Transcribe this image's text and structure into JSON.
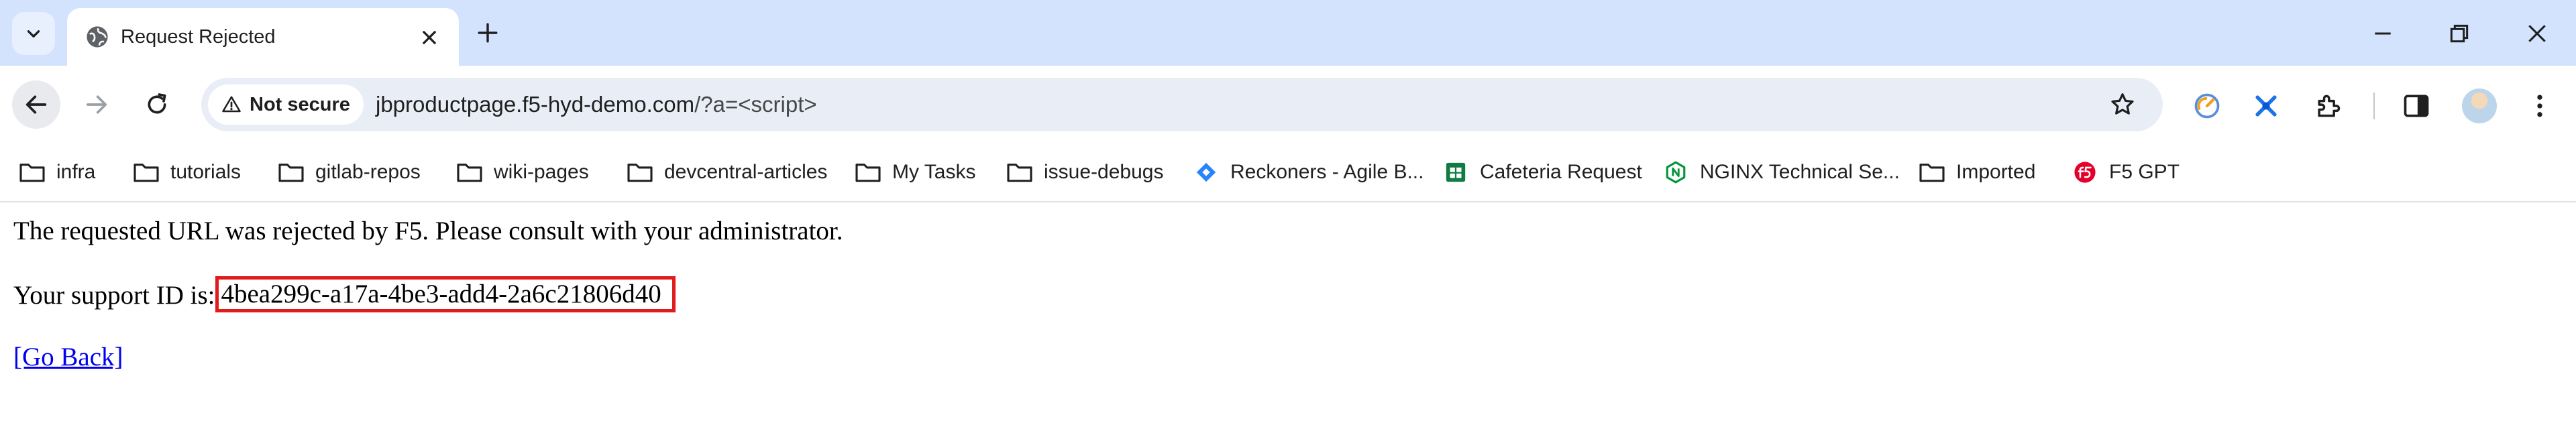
{
  "tab": {
    "title": "Request Rejected"
  },
  "toolbar": {
    "security_chip": "Not secure",
    "url_host": "jbproductpage.f5-hyd-demo.com",
    "url_path": "/?a=<script>"
  },
  "bookmarks": [
    {
      "label": "infra",
      "icon": "folder-icon"
    },
    {
      "label": "tutorials",
      "icon": "folder-icon"
    },
    {
      "label": "gitlab-repos",
      "icon": "folder-icon"
    },
    {
      "label": "wiki-pages",
      "icon": "folder-icon"
    },
    {
      "label": "devcentral-articles",
      "icon": "folder-icon"
    },
    {
      "label": "My Tasks",
      "icon": "folder-icon"
    },
    {
      "label": "issue-debugs",
      "icon": "folder-icon"
    },
    {
      "label": "Reckoners - Agile B...",
      "icon": "jira-diamond-icon"
    },
    {
      "label": "Cafeteria Request",
      "icon": "sheets-icon"
    },
    {
      "label": "NGINX Technical Se...",
      "icon": "nginx-icon"
    },
    {
      "label": "Imported",
      "icon": "folder-icon"
    },
    {
      "label": "F5 GPT",
      "icon": "f5-logo-icon"
    }
  ],
  "page": {
    "message": "The requested URL was rejected by F5. Please consult with your administrator.",
    "support_label": "Your support ID is:",
    "support_id": "4bea299c-a17a-4be3-add4-2a6c21806d40",
    "go_back": "[Go Back]"
  },
  "colors": {
    "tabstrip": "#d3e3fd",
    "highlight_box": "#e01b1b",
    "link": "#0000ee"
  }
}
